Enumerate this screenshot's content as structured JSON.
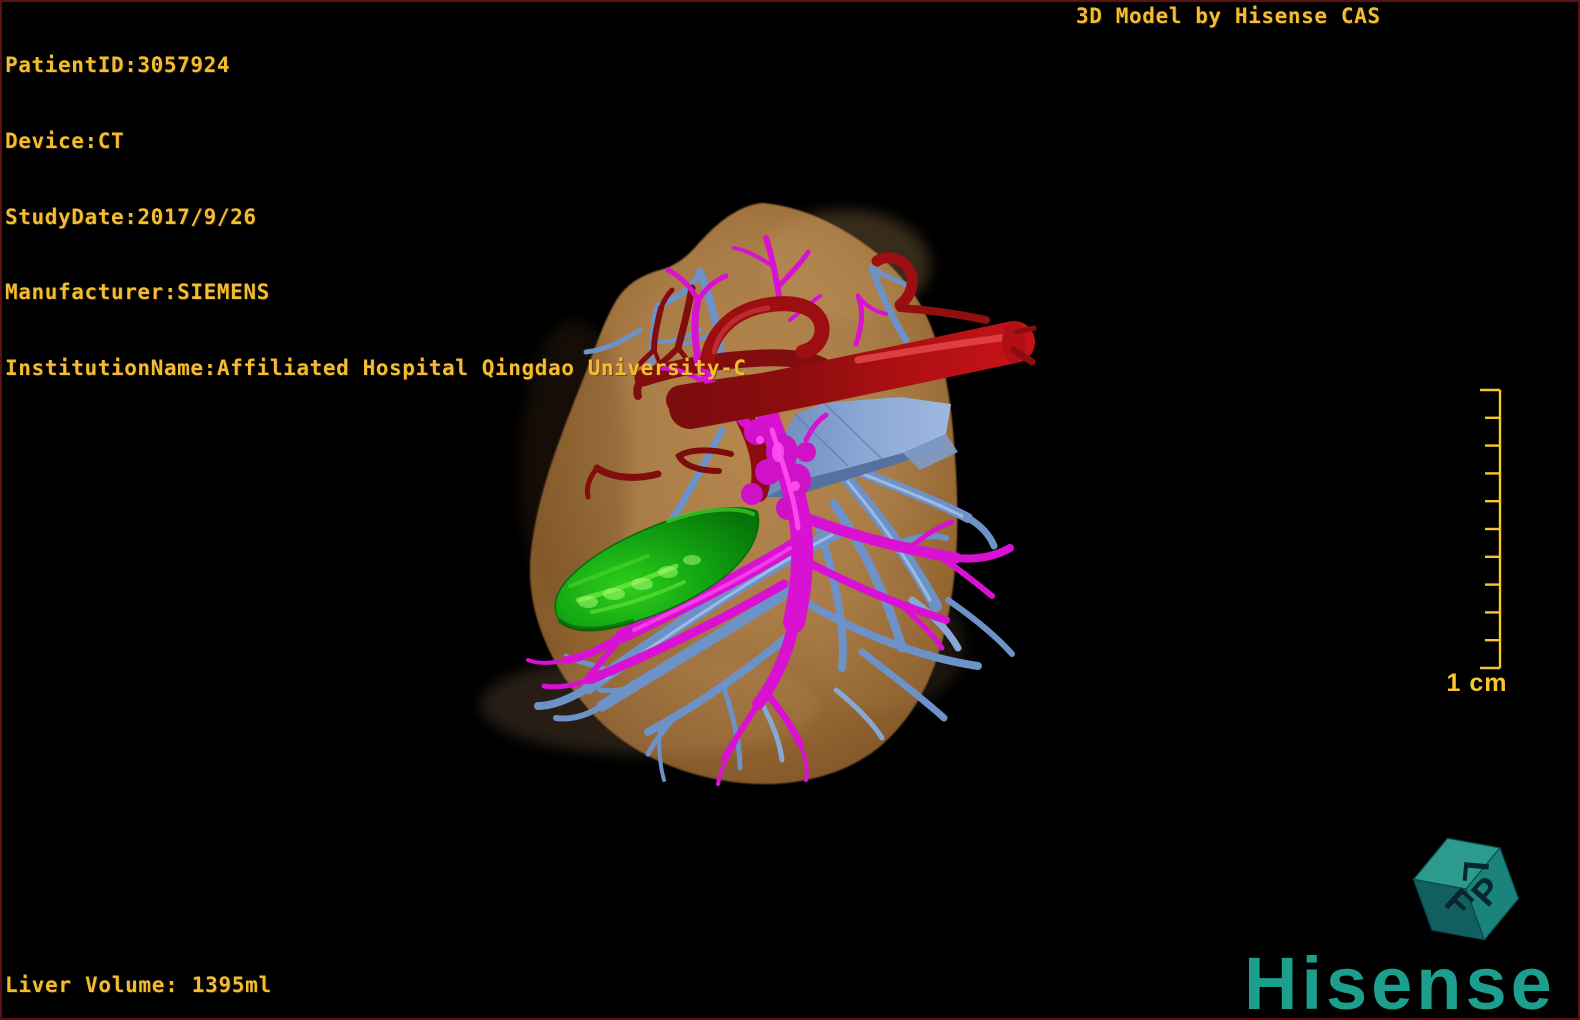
{
  "header": {
    "lines": [
      "PatientID:3057924",
      "Device:CT",
      "StudyDate:2017/9/26",
      "Manufacturer:SIEMENS",
      "InstitutionName:Affiliated Hospital Qingdao University-C"
    ],
    "title": "3D Model by Hisense CAS"
  },
  "footer": {
    "liver_volume": "Liver Volume: 1395ml"
  },
  "scale_bar": {
    "label": "1 cm",
    "tick_intervals": 10
  },
  "branding": {
    "wordmark": "Hisense",
    "cube_letters": {
      "top": "L",
      "left": "F",
      "right": "P"
    }
  },
  "colors": {
    "background": "#000000",
    "frame": "#5c1111",
    "overlay_text": "#f2bd2e",
    "scale_bar": "#f9c62e",
    "brand_teal": "#1d9f8d",
    "liver": "#a97c47",
    "hepatic_artery": "#b01015",
    "portal_vein": "#d911d3",
    "hepatic_vein": "#6d92c8",
    "gallbladder": "#12a412",
    "plane": "#8aa6d4"
  },
  "model": {
    "structures": [
      {
        "name": "liver",
        "color": "#a97c47"
      },
      {
        "name": "hepatic-artery",
        "color": "#b01015"
      },
      {
        "name": "portal-vein",
        "color": "#d911d3"
      },
      {
        "name": "hepatic-veins",
        "color": "#6d92c8"
      },
      {
        "name": "gallbladder",
        "color": "#12a412"
      },
      {
        "name": "resection-plane",
        "color": "#8aa6d4"
      }
    ]
  }
}
